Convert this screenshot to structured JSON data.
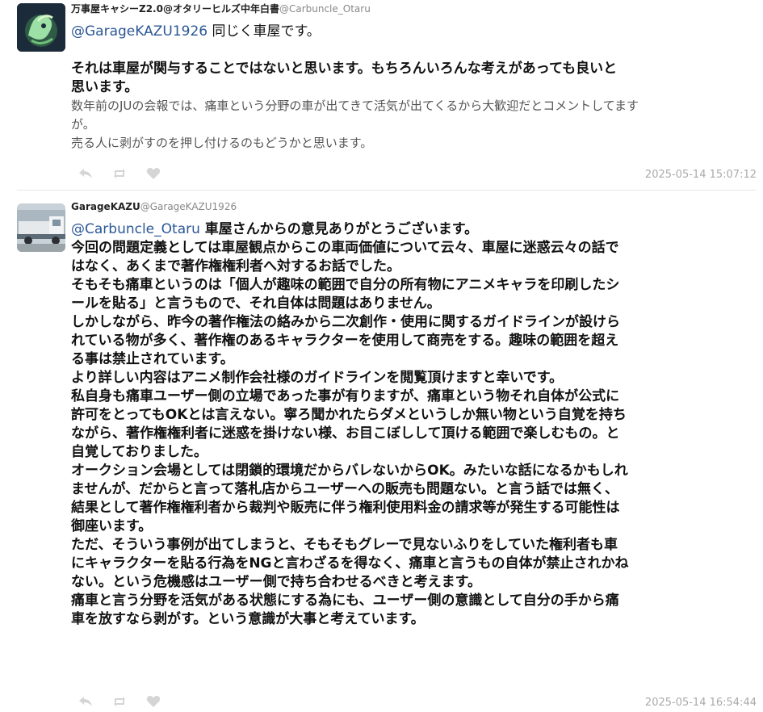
{
  "posts": [
    {
      "display_name": "万事屋キャシーZ2.0@オタリーヒルズ中年白書",
      "handle": "@Carbuncle_Otaru",
      "reply_to": "@GarageKAZU1926",
      "lines": [
        "同じく車屋です。",
        "それは車屋が関与することではないと思います。もちろんいろんな考えがあっても良いと",
        "思います。",
        "数年前のJUの会報では、痛車という分野の車が出てきて活気が出てくるから大歓迎だとコメントしてます",
        "が。",
        "売る人に剥がすのを押し付けるのもどうかと思います。"
      ],
      "timestamp": "2025-05-14 15:07:12"
    },
    {
      "display_name": "GarageKAZU",
      "handle": "@GarageKAZU1926",
      "reply_to": "@Carbuncle_Otaru",
      "lines": [
        "車屋さんからの意見ありがとうございます。",
        "今回の問題定義としては車屋観点からこの車両価値について云々、車屋に迷惑云々の話で",
        "はなく、あくまで著作権権利者へ対するお話でした。",
        "そもそも痛車というのは「個人が趣味の範囲で自分の所有物にアニメキャラを印刷したシ",
        "ールを貼る」と言うもので、それ自体は問題はありません。",
        "しかしながら、昨今の著作権法の絡みから二次創作・使用に関するガイドラインが設けら",
        "れている物が多く、著作権のあるキャラクターを使用して商売をする。趣味の範囲を超え",
        "る事は禁止されています。",
        "より詳しい内容はアニメ制作会社様のガイドラインを閲覧頂けますと幸いです。",
        "私自身も痛車ユーザー側の立場であった事が有りますが、痛車という物それ自体が公式に",
        "許可をとってもOKとは言えない。寧ろ聞かれたらダメというしか無い物という自覚を持ち",
        "ながら、著作権権利者に迷惑を掛けない様、お目こぼしして頂ける範囲で楽しむもの。と",
        "自覚しておりました。",
        "オークション会場としては閉鎖的環境だからバレないからOK。みたいな話になるかもしれ",
        "ませんが、だからと言って落札店からユーザーへの販売も問題ない。と言う話では無く、",
        "結果として著作権権利者から裁判や販売に伴う権利使用料金の請求等が発生する可能性は",
        "御座います。",
        "ただ、そういう事例が出てしまうと、そもそもグレーで見ないふりをしていた権利者も車",
        "にキャラクターを貼る行為をNGと言わざるを得なく、痛車と言うもの自体が禁止されかね",
        "ない。という危機感はユーザー側で持ち合わせるべきと考えます。",
        "痛車と言う分野を活気がある状態にする為にも、ユーザー側の意識として自分の手から痛",
        "車を放すなら剥がす。という意識が大事と考えています。"
      ],
      "timestamp": "2025-05-14 16:54:44"
    }
  ],
  "icons": {
    "reply": "reply-icon",
    "boost": "boost-icon",
    "favourite": "heart-icon"
  },
  "colors": {
    "mention": "#2b5797",
    "muted": "#aaaaaa"
  }
}
